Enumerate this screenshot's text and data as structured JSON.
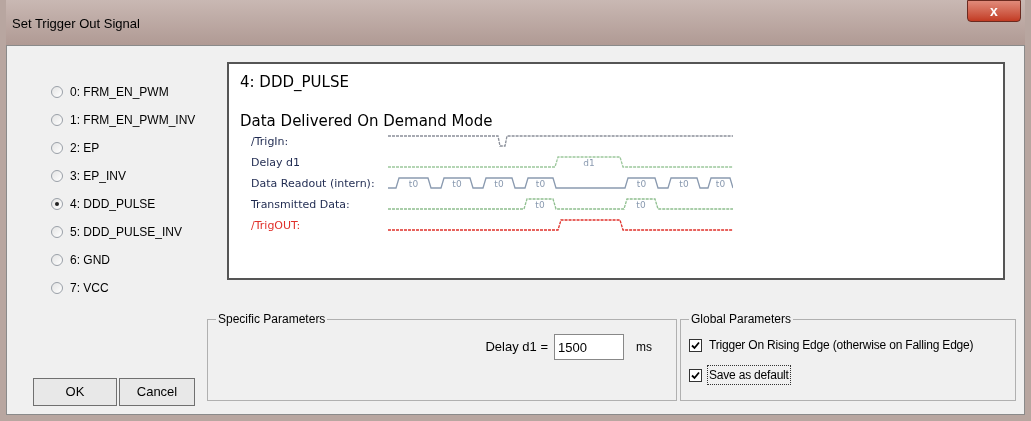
{
  "window": {
    "title": "Set Trigger Out Signal",
    "close": "x"
  },
  "modes": [
    {
      "label": "0: FRM_EN_PWM",
      "selected": false
    },
    {
      "label": "1: FRM_EN_PWM_INV",
      "selected": false
    },
    {
      "label": "2: EP",
      "selected": false
    },
    {
      "label": "3: EP_INV",
      "selected": false
    },
    {
      "label": "4: DDD_PULSE",
      "selected": true
    },
    {
      "label": "5: DDD_PULSE_INV",
      "selected": false
    },
    {
      "label": "6: GND",
      "selected": false
    },
    {
      "label": "7: VCC",
      "selected": false
    }
  ],
  "diagram": {
    "heading": "4: DDD_PULSE",
    "title": "Data Delivered On Demand Mode",
    "signals": [
      {
        "kind": "trigger_in",
        "name": "/TrigIn:",
        "color": "#1f2a50"
      },
      {
        "kind": "delay",
        "name": "Delay d1",
        "color": "#1f2a50",
        "pulse_labels": [
          "d1"
        ]
      },
      {
        "kind": "readout",
        "name": "Data Readout (intern):",
        "color": "#1f2a50",
        "pulse_labels": [
          "t0",
          "t0",
          "t0",
          "t0",
          "t0",
          "t0",
          "t0"
        ]
      },
      {
        "kind": "transmitted",
        "name": "Transmitted Data:",
        "color": "#1f2a50",
        "pulse_labels": [
          "t0",
          "t0"
        ]
      },
      {
        "kind": "trigger_out",
        "name": "/TrigOUT:",
        "color": "#e0302a"
      }
    ]
  },
  "buttons": {
    "ok": "OK",
    "cancel": "Cancel"
  },
  "specific_parameters": {
    "title": "Specific Parameters",
    "label": "Delay d1 =",
    "value": "1500",
    "unit": "ms"
  },
  "global_parameters": {
    "title": "Global Parameters",
    "options": [
      {
        "label": "Trigger On Rising Edge (otherwise on Falling Edge)",
        "checked": true,
        "focused": false
      },
      {
        "label": "Save as default",
        "checked": true,
        "focused": true
      }
    ]
  }
}
